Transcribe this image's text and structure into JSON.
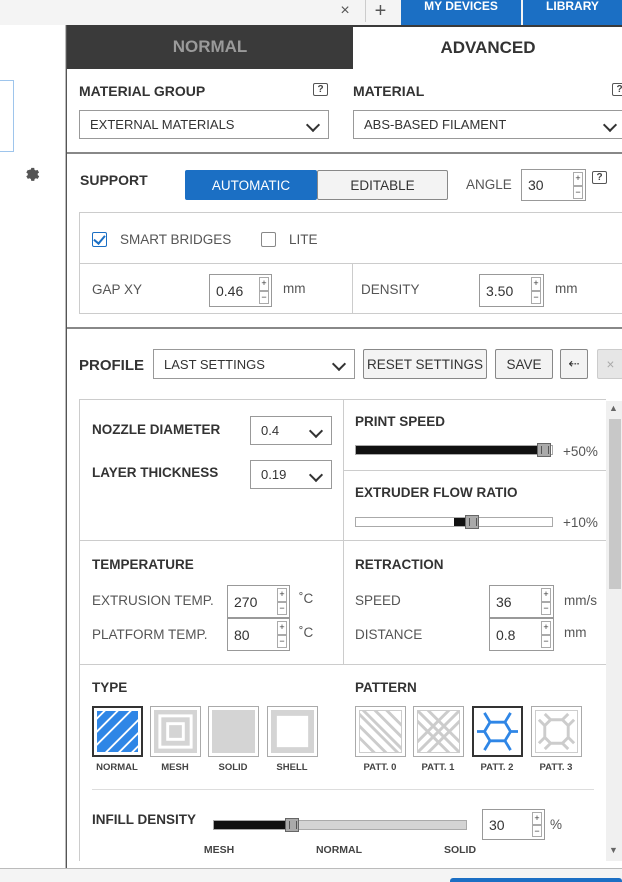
{
  "topbar": {
    "close_glyph": "×",
    "add_glyph": "+",
    "tabs": [
      "MY DEVICES",
      "LIBRARY"
    ]
  },
  "modes": {
    "normal": "NORMAL",
    "advanced": "ADVANCED"
  },
  "material": {
    "group_label": "MATERIAL GROUP",
    "group_value": "EXTERNAL MATERIALS",
    "label": "MATERIAL",
    "value": "ABS-BASED FILAMENT",
    "help": "?"
  },
  "support": {
    "label": "SUPPORT",
    "automatic": "AUTOMATIC",
    "editable": "EDITABLE",
    "angle_label": "ANGLE",
    "angle_value": "30",
    "smart_bridges": "SMART BRIDGES",
    "lite": "LITE",
    "gap_label": "GAP XY",
    "gap_value": "0.46",
    "density_label": "DENSITY",
    "density_value": "3.50",
    "unit": "mm"
  },
  "profile": {
    "label": "PROFILE",
    "value": "LAST SETTINGS",
    "reset": "RESET SETTINGS",
    "save": "SAVE",
    "back_glyph": "⇠",
    "close_glyph": "×"
  },
  "settings": {
    "nozzle_label": "NOZZLE DIAMETER",
    "nozzle_value": "0.4",
    "layer_label": "LAYER THICKNESS",
    "layer_value": "0.19",
    "print_speed_label": "PRINT SPEED",
    "print_speed_value": "+50%",
    "print_speed_level": 0.96,
    "flow_label": "EXTRUDER FLOW RATIO",
    "flow_value": "+10%",
    "flow_level": 0.59,
    "temp_label": "TEMPERATURE",
    "extrusion_label": "EXTRUSION TEMP.",
    "extrusion_value": "270",
    "platform_label": "PLATFORM TEMP.",
    "platform_value": "80",
    "celsius": "˚C",
    "retraction_label": "RETRACTION",
    "speed_label": "SPEED",
    "speed_value": "36",
    "speed_unit": "mm/s",
    "distance_label": "DISTANCE",
    "distance_value": "0.8",
    "distance_unit": "mm"
  },
  "infill": {
    "type_label": "TYPE",
    "types": [
      "NORMAL",
      "MESH",
      "SOLID",
      "SHELL"
    ],
    "pattern_label": "PATTERN",
    "patterns": [
      "PATT. 0",
      "PATT. 1",
      "PATT. 2",
      "PATT. 3"
    ],
    "density_label": "INFILL DENSITY",
    "density_value": "30",
    "density_level": 0.31,
    "percent": "%",
    "scale": [
      "MESH",
      "NORMAL",
      "SOLID"
    ]
  },
  "colors": {
    "accent": "#1b6fc4",
    "dark": "#3a3a3a"
  }
}
